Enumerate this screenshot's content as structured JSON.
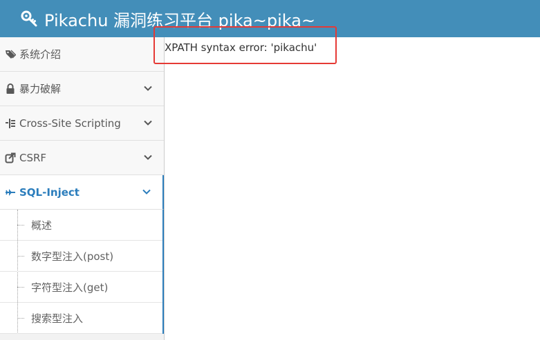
{
  "header": {
    "title": "Pikachu 漏洞练习平台 pika~pika~",
    "icon": "key-icon"
  },
  "sidebar": {
    "items": [
      {
        "label": "系统介绍",
        "icon": "tags-icon",
        "expandable": false
      },
      {
        "label": "暴力破解",
        "icon": "lock-icon",
        "expandable": true
      },
      {
        "label": "Cross-Site Scripting",
        "icon": "code-tree-icon",
        "expandable": true
      },
      {
        "label": "CSRF",
        "icon": "share-icon",
        "expandable": true
      },
      {
        "label": "SQL-Inject",
        "icon": "plane-icon",
        "expandable": true,
        "active": true
      }
    ],
    "sql_submenu": [
      {
        "label": "概述"
      },
      {
        "label": "数字型注入(post)"
      },
      {
        "label": "字符型注入(get)"
      },
      {
        "label": "搜索型注入"
      }
    ]
  },
  "main": {
    "error_message": "XPATH syntax error: 'pikachu'"
  },
  "colors": {
    "navbar": "#438eb9",
    "accent": "#2b7dbc",
    "highlight": "#e53935"
  }
}
